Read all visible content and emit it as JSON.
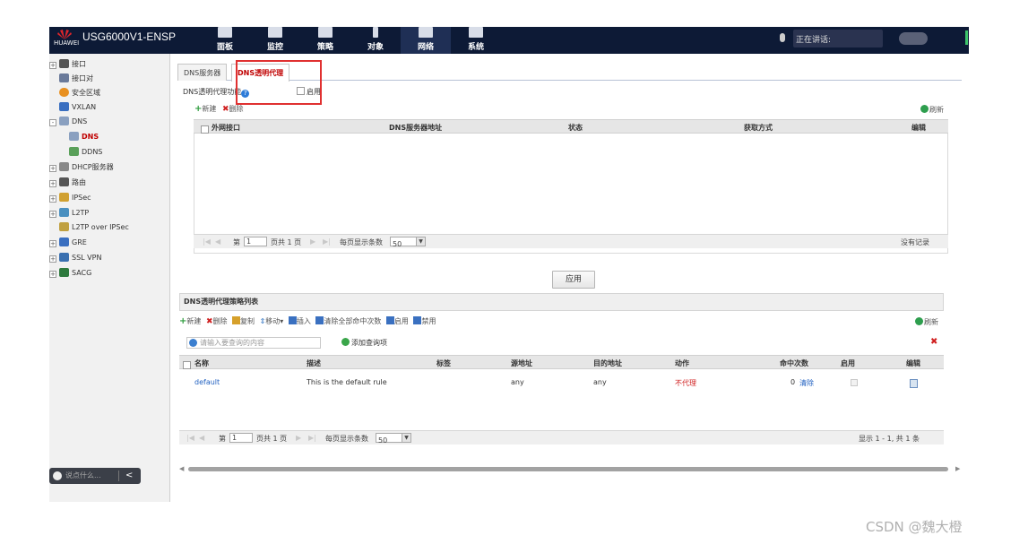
{
  "brand": {
    "vendor": "HUAWEI",
    "product": "USG6000V1-ENSP"
  },
  "nav": [
    {
      "label": "面板",
      "icon": "dashboard-icon"
    },
    {
      "label": "监控",
      "icon": "monitor-icon"
    },
    {
      "label": "策略",
      "icon": "policy-icon"
    },
    {
      "label": "对象",
      "icon": "object-icon"
    },
    {
      "label": "网络",
      "icon": "network-icon",
      "active": true
    },
    {
      "label": "系统",
      "icon": "system-icon"
    }
  ],
  "top_status": {
    "speaking": "正在讲话:"
  },
  "sidebar": {
    "items": [
      {
        "label": "接口",
        "expander": "+"
      },
      {
        "label": "接口对"
      },
      {
        "label": "安全区域"
      },
      {
        "label": "VXLAN"
      },
      {
        "label": "DNS",
        "expander": "-"
      },
      {
        "label": "DNS",
        "selected": true
      },
      {
        "label": "DDNS"
      },
      {
        "label": "DHCP服务器",
        "expander": "+"
      },
      {
        "label": "路由",
        "expander": "+"
      },
      {
        "label": "IPSec",
        "expander": "+"
      },
      {
        "label": "L2TP",
        "expander": "+"
      },
      {
        "label": "L2TP over IPSec"
      },
      {
        "label": "GRE",
        "expander": "+"
      },
      {
        "label": "SSL VPN",
        "expander": "+"
      },
      {
        "label": "SACG",
        "expander": "+"
      }
    ],
    "chat_placeholder": "说点什么...",
    "chat_back": "<"
  },
  "tabs": [
    {
      "label": "DNS服务器"
    },
    {
      "label": "DNS透明代理",
      "active": true
    }
  ],
  "proxy": {
    "function_label": "DNS透明代理功能",
    "help": "?",
    "enable_label": "启用"
  },
  "toolbar1": {
    "new": "新建",
    "delete": "删除",
    "refresh": "刷新"
  },
  "grid1": {
    "columns": [
      "外网接口",
      "DNS服务器地址",
      "状态",
      "获取方式",
      "编辑"
    ],
    "pager": {
      "page_prefix": "第",
      "page": "1",
      "page_total": "页共 1 页",
      "per_page_label": "每页显示条数",
      "per_page": "50",
      "status": "没有记录"
    }
  },
  "apply_label": "应用",
  "policy": {
    "title": "DNS透明代理策略列表",
    "toolbar": {
      "new": "新建",
      "delete": "删除",
      "copy": "复制",
      "move": "移动▾",
      "insert": "插入",
      "clear_hits": "清除全部命中次数",
      "enable": "启用",
      "disable": "禁用",
      "refresh": "刷新"
    },
    "search_placeholder": "请输入要查询的内容",
    "add_condition": "添加查询项",
    "columns": [
      "名称",
      "描述",
      "标签",
      "源地址",
      "目的地址",
      "动作",
      "命中次数",
      "启用",
      "编辑"
    ],
    "rows": [
      {
        "name": "default",
        "desc": "This is the default rule",
        "tag": "",
        "src": "any",
        "dst": "any",
        "action": "不代理",
        "hits": "0",
        "clear": "清除"
      }
    ],
    "pager": {
      "page_prefix": "第",
      "page": "1",
      "page_total": "页共 1 页",
      "per_page_label": "每页显示条数",
      "per_page": "50",
      "status": "显示 1 - 1, 共 1 条"
    }
  },
  "watermark": "CSDN @魏大橙"
}
